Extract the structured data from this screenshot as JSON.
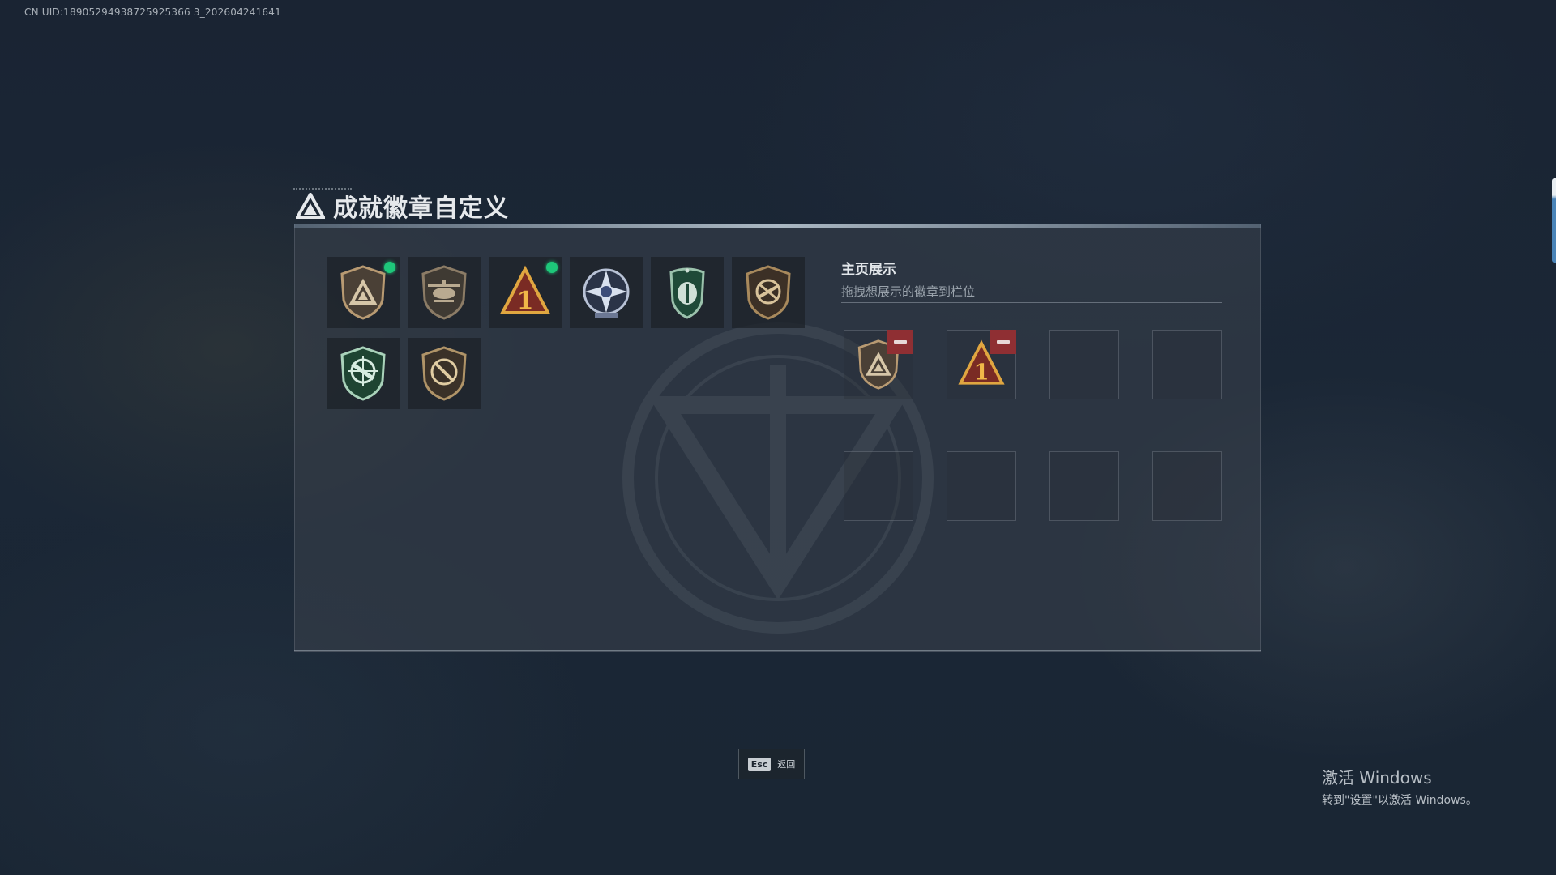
{
  "meta": {
    "uid_text": "CN UID:18905294938725925366 3_202604241641"
  },
  "header": {
    "title": "成就徽章自定义"
  },
  "badges": [
    {
      "name": "bronze-delta-shield-badge",
      "has_new": true
    },
    {
      "name": "helicopter-shield-badge",
      "has_new": false
    },
    {
      "name": "number-one-triangle-badge",
      "has_new": true
    },
    {
      "name": "star-compass-badge",
      "has_new": false
    },
    {
      "name": "green-crest-badge",
      "has_new": false
    },
    {
      "name": "no-sniper-shield-badge",
      "has_new": false
    },
    {
      "name": "green-crosshair-rifle-badge",
      "has_new": false
    },
    {
      "name": "no-sniper-round-badge",
      "has_new": false
    }
  ],
  "display": {
    "title": "主页展示",
    "subtitle": "拖拽想展示的徽章到栏位",
    "slots": [
      {
        "filled": true,
        "badge": "bronze-delta-shield-badge"
      },
      {
        "filled": true,
        "badge": "number-one-triangle-badge"
      },
      {
        "filled": false
      },
      {
        "filled": false
      },
      {
        "filled": false
      },
      {
        "filled": false
      },
      {
        "filled": false
      },
      {
        "filled": false
      }
    ]
  },
  "footer": {
    "esc_key": "Esc",
    "esc_label": "返回"
  },
  "windows_activation": {
    "line1": "激活 Windows",
    "line2": "转到\"设置\"以激活 Windows。"
  },
  "colors": {
    "new_dot": "#1ec77a",
    "remove_button": "#8f2f33",
    "background": "#1b2736"
  }
}
